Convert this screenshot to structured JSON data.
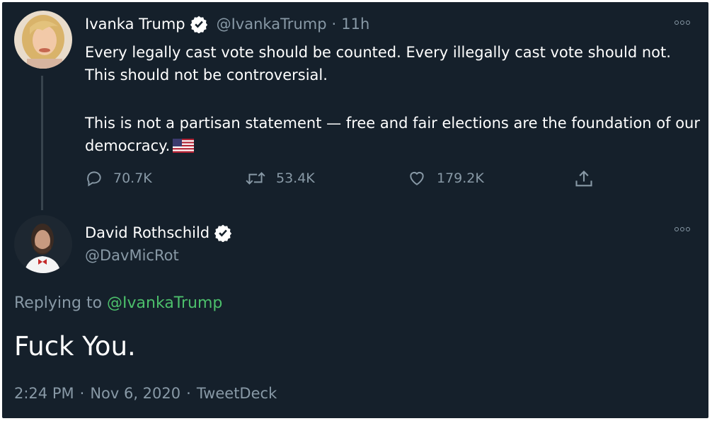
{
  "tweet": {
    "author_name": "Ivanka Trump",
    "handle": "@IvankaTrump",
    "separator": "·",
    "time_ago": "11h",
    "text_p1": "Every legally cast vote should be counted. Every illegally cast vote should not. This should not be controversial.",
    "text_p2": "This is not a partisan statement — free and fair elections are the foundation of our democracy.",
    "replies": "70.7K",
    "retweets": "53.4K",
    "likes": "179.2K"
  },
  "reply": {
    "author_name": "David Rothschild",
    "handle": "@DavMicRot",
    "replying_prefix": "Replying to",
    "replying_to": "@IvankaTrump",
    "text": "Fuck You.",
    "time": "2:24 PM",
    "date": "Nov 6, 2020",
    "source": "TweetDeck",
    "separator": "·"
  },
  "colors": {
    "background": "#15202b",
    "text_primary": "#ffffff",
    "text_secondary": "#8899a6",
    "mention": "#4cbf6b"
  }
}
